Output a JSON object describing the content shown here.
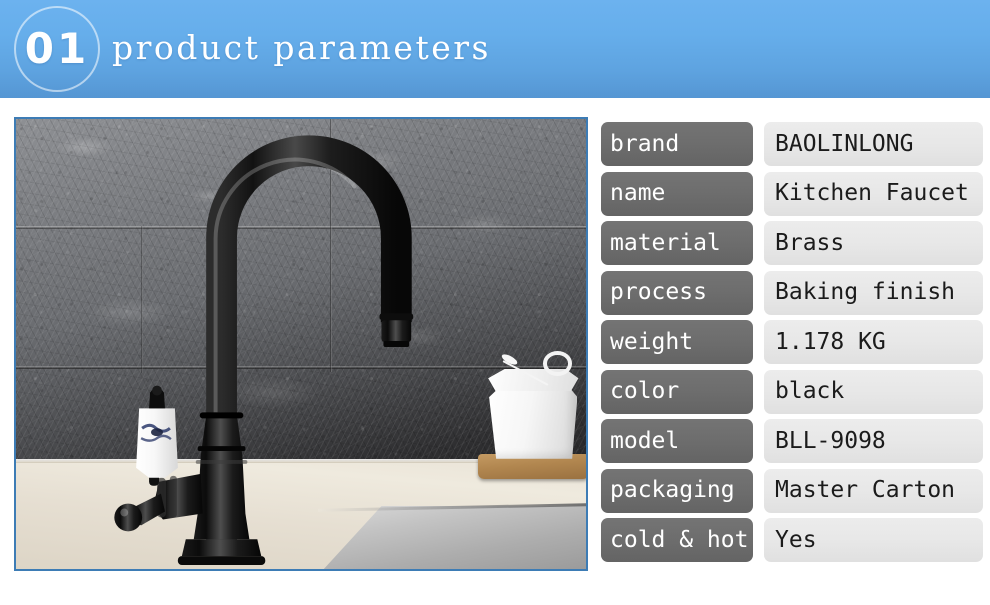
{
  "header": {
    "badge_number": "01",
    "title": "product parameters",
    "accent_color": "#5ea3e0",
    "badge_ring_color": "#ffffff"
  },
  "photo": {
    "alt_name": "kitchen-faucet-photo",
    "border_color": "#3d7cb5",
    "scene_objects": [
      "black-gooseneck-kitchen-faucet",
      "white-ceramic-lever-handle",
      "gray-stone-tile-wall",
      "cream-stone-countertop",
      "stainless-steel-sink",
      "white-ceramic-sugar-bowl",
      "wooden-serving-board"
    ],
    "faucet_color": "#141414",
    "handle_color": "#f2f2f2"
  },
  "parameters": {
    "key_chip_color": "#6d6d6d",
    "value_chip_color": "#e7e7e7",
    "rows": [
      {
        "key": "brand",
        "value": "BAOLINLONG"
      },
      {
        "key": "name",
        "value": "Kitchen Faucet"
      },
      {
        "key": "material",
        "value": "Brass"
      },
      {
        "key": "process",
        "value": "Baking finish"
      },
      {
        "key": "weight",
        "value": "1.178 KG"
      },
      {
        "key": "color",
        "value": "black"
      },
      {
        "key": "model",
        "value": "BLL-9098"
      },
      {
        "key": "packaging",
        "value": "Master Carton"
      },
      {
        "key": "cold & hot",
        "value": "Yes"
      }
    ]
  }
}
